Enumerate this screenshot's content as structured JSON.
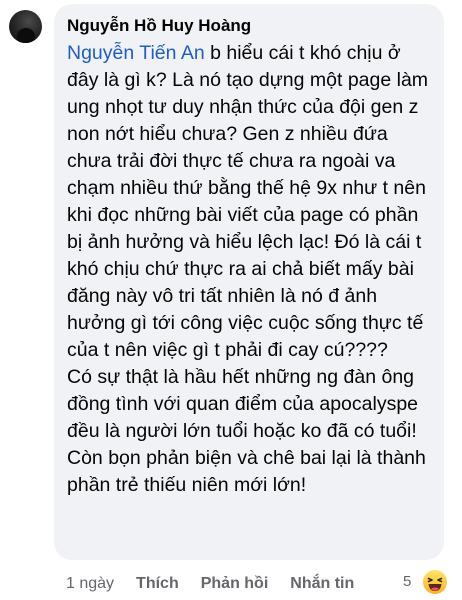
{
  "comment": {
    "author": "Nguyễn Hồ Huy Hoàng",
    "mention": "Nguyễn Tiến An",
    "paragraph_1": " b hiểu cái t khó chịu ở đây là gì k? Là nó tạo dựng một page làm ung nhọt tư duy nhận thức của đội gen z non nớt hiểu chưa? Gen z nhiều đứa chưa trải đời thực tế chưa ra ngoài va chạm nhiều thứ bằng thế hệ 9x như t nên khi đọc những bài viết của page có phần bị ảnh hưởng và hiểu lệch lạc! Đó là cái t khó chịu chứ thực ra ai chả biết mấy bài đăng này vô tri tất nhiên là nó đ ảnh hưởng gì tới công việc cuộc sống thực tế của t nên việc gì t phải đi cay cú????",
    "paragraph_2": "Có sự thật là hầu hết những ng đàn ông đồng tình với quan điểm của apocalyspe đều là người lớn tuổi hoặc ko đã có tuổi! Còn bọn phản biện và chê bai lại là thành phần trẻ thiếu niên mới lớn!"
  },
  "meta": {
    "time": "1 ngày",
    "like": "Thích",
    "reply": "Phản hồi",
    "message": "Nhắn tin",
    "reaction_count": "5"
  },
  "icons": {
    "avatar": "avatar",
    "reaction": "haha-icon"
  },
  "colors": {
    "mention": "#1f5ec8",
    "bubble": "#f0f2f5",
    "meta_text": "#65676b"
  }
}
